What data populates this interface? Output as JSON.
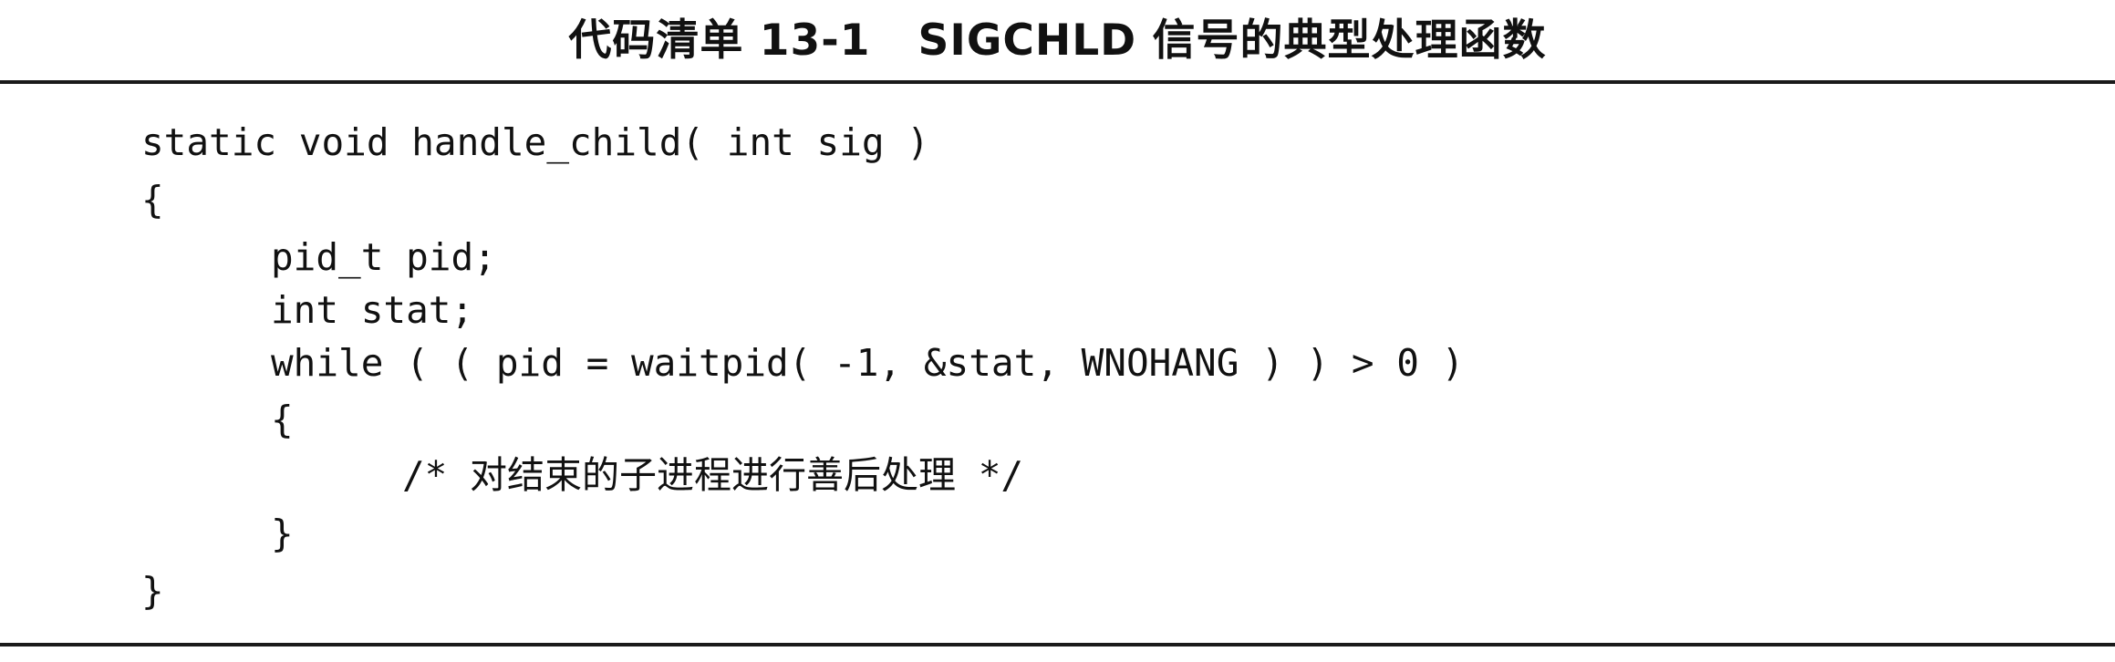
{
  "caption": "代码清单 13-1   SIGCHLD 信号的典型处理函数",
  "code_lines": [
    "static void handle_child( int sig )",
    "{",
    "pid_t pid;",
    "int stat;",
    "while ( ( pid = waitpid( -1, &stat, WNOHANG ) ) > 0 )",
    "{",
    "/* 对结束的子进程进行善后处理 */",
    "}",
    "}"
  ]
}
